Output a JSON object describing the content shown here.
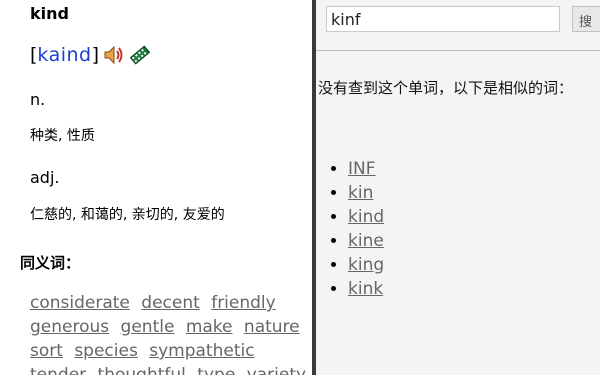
{
  "left": {
    "word": "kind",
    "phonetic_open": "[",
    "phonetic": "kaind",
    "phonetic_close": "]",
    "icons": [
      "speaker-icon",
      "film-icon"
    ],
    "entries": [
      {
        "pos": "n.",
        "definition": "种类, 性质"
      },
      {
        "pos": "adj.",
        "definition": "仁慈的, 和蔼的, 亲切的, 友爱的"
      }
    ],
    "synonyms_title": "同义词：",
    "synonyms": [
      "considerate",
      "decent",
      "friendly",
      "generous",
      "gentle",
      "make",
      "nature",
      "sort",
      "species",
      "sympathetic",
      "tender",
      "thoughtful",
      "type",
      "variety"
    ]
  },
  "right": {
    "search_value": "kinf",
    "search_button_label": "搜",
    "not_found_text": "没有查到这个单词，以下是相似的词：",
    "suggestions": [
      "INF",
      "kin",
      "kind",
      "kine",
      "king",
      "kink"
    ]
  },
  "colors": {
    "phonetic": "#1a3fd0",
    "link": "#666666",
    "divider": "#3a3a3a",
    "right_bg": "#f4f4f4"
  }
}
